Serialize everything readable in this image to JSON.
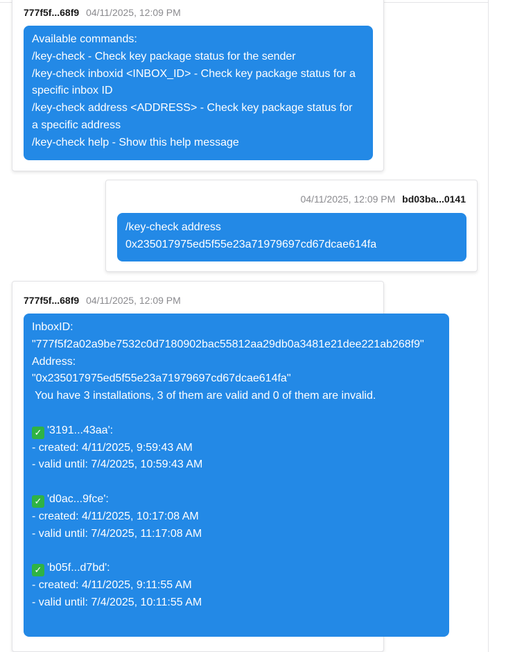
{
  "messages": [
    {
      "sender": "777f5f...68f9",
      "time": "04/11/2025, 12:09 PM",
      "lines": [
        "Available commands:",
        "/key-check - Check key package status for the sender",
        "/key-check inboxid <INBOX_ID> - Check key package status for a",
        "specific inbox ID",
        "/key-check address <ADDRESS> - Check key package status for",
        "a specific address",
        "/key-check help - Show this help message"
      ]
    },
    {
      "sender": "bd03ba...0141",
      "time": "04/11/2025, 12:09 PM",
      "lines": [
        "/key-check address",
        "0x235017975ed5f55e23a71979697cd67dcae614fa"
      ]
    },
    {
      "sender": "777f5f...68f9",
      "time": "04/11/2025, 12:09 PM",
      "header_lines": [
        "InboxID:",
        "\"777f5f2a02a9be7532c0d7180902bac55812aa29db0a3481e21dee221ab268f9\"",
        "Address:",
        "\"0x235017975ed5f55e23a71979697cd67dcae614fa\"",
        " You have 3 installations, 3 of them are valid and 0 of them are invalid."
      ],
      "installations": [
        {
          "id": "'3191...43aa':",
          "created": "- created: 4/11/2025, 9:59:43 AM",
          "valid_until": "- valid until: 7/4/2025, 10:59:43 AM"
        },
        {
          "id": "'d0ac...9fce':",
          "created": "- created: 4/11/2025, 10:17:08 AM",
          "valid_until": "- valid until: 7/4/2025, 11:17:08 AM"
        },
        {
          "id": "'b05f...d7bd':",
          "created": "- created: 4/11/2025, 9:11:55 AM",
          "valid_until": "- valid until: 7/4/2025, 10:11:55 AM"
        }
      ],
      "valid_mark": "✓"
    }
  ],
  "colors": {
    "bubble": "#2389e6",
    "check": "#2fb344"
  }
}
